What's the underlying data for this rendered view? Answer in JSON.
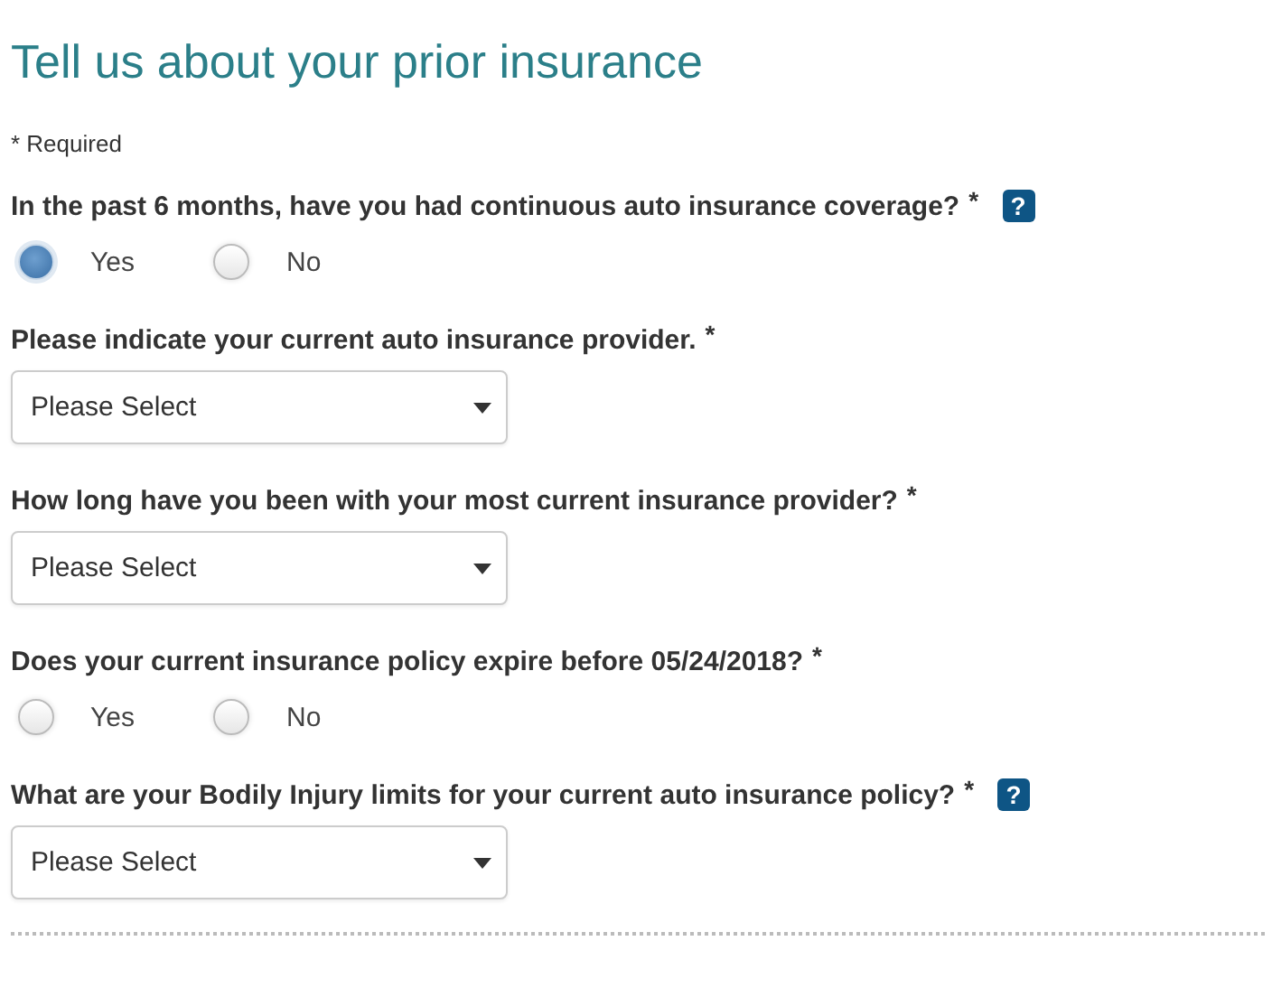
{
  "title": "Tell us about your prior insurance",
  "required_note": "* Required",
  "questions": [
    {
      "kind": "radio",
      "label": "In the past 6 months, have you had continuous auto insurance coverage?",
      "required_mark": "*",
      "help": "?",
      "options": [
        {
          "label": "Yes",
          "selected": true
        },
        {
          "label": "No",
          "selected": false
        }
      ]
    },
    {
      "kind": "select",
      "label": "Please indicate your current auto insurance provider.",
      "required_mark": "*",
      "value": "Please Select"
    },
    {
      "kind": "select",
      "label": "How long have you been with your most current insurance provider?",
      "required_mark": "*",
      "value": "Please Select"
    },
    {
      "kind": "radio",
      "label": "Does your current insurance policy expire before 05/24/2018?",
      "required_mark": "*",
      "options": [
        {
          "label": "Yes",
          "selected": false
        },
        {
          "label": "No",
          "selected": false
        }
      ]
    },
    {
      "kind": "select",
      "label": "What are your Bodily Injury limits for your current auto insurance policy?",
      "required_mark": "*",
      "help": "?",
      "value": "Please Select"
    }
  ]
}
